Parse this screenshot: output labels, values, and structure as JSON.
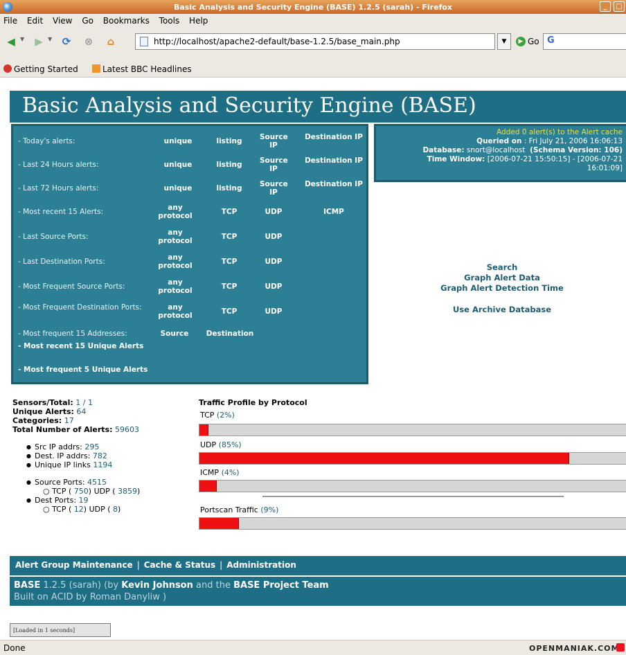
{
  "window": {
    "title": "Basic Analysis and Security Engine (BASE) 1.2.5 (sarah) - Firefox"
  },
  "menubar": [
    "File",
    "Edit",
    "View",
    "Go",
    "Bookmarks",
    "Tools",
    "Help"
  ],
  "navbar": {
    "url": "http://localhost/apache2-default/base-1.2.5/base_main.php",
    "go_label": "Go",
    "search_value": "G"
  },
  "bookmarks": [
    "Getting Started",
    "Latest BBC Headlines"
  ],
  "base": {
    "title": "Basic Analysis and Security Engine (BASE)",
    "menu": [
      {
        "label": "- Today's alerts:",
        "links": [
          "unique",
          "listing",
          "Source IP",
          "Destination IP"
        ]
      },
      {
        "label": "- Last 24 Hours alerts:",
        "links": [
          "unique",
          "listing",
          "Source IP",
          "Destination IP"
        ]
      },
      {
        "label": "- Last 72 Hours alerts:",
        "links": [
          "unique",
          "listing",
          "Source IP",
          "Destination IP"
        ]
      },
      {
        "label": "- Most recent 15 Alerts:",
        "links": [
          "any protocol",
          "TCP",
          "UDP",
          "ICMP"
        ]
      },
      {
        "label": "- Last Source Ports:",
        "links": [
          "any protocol",
          "TCP",
          "UDP"
        ]
      },
      {
        "label": "- Last Destination Ports:",
        "links": [
          "any protocol",
          "TCP",
          "UDP"
        ]
      },
      {
        "label": "- Most Frequent Source Ports:",
        "links": [
          "any protocol",
          "TCP",
          "UDP"
        ]
      },
      {
        "label": "- Most Frequent Destination Ports:",
        "links": [
          "any protocol",
          "TCP",
          "UDP"
        ]
      },
      {
        "label": "- Most frequent 15 Addresses:",
        "links": [
          "Source",
          "Destination"
        ]
      }
    ],
    "unique_recent": "- Most recent 15 Unique Alerts",
    "unique_frequent": "- Most frequent 5 Unique Alerts",
    "info": {
      "added": "Added 0 alert(s) to the Alert cache",
      "queried_label": "Queried on",
      "queried_value": ": Fri July 21, 2006 16:06:13",
      "database_label": "Database:",
      "database_value": "snort@localhost",
      "schema": "(Schema Version: 106)",
      "window_label": "Time Window:",
      "window_value": "[2006-07-21 15:50:15] - [2006-07-21",
      "window_value2": "16:01:09]"
    },
    "right_links": [
      "Search",
      "Graph Alert Data",
      "Graph Alert Detection Time",
      "Use Archive Database"
    ],
    "stats": {
      "sensors_label": "Sensors/Total:",
      "sensors_value": "1 / 1",
      "unique_label": "Unique Alerts:",
      "unique_value": "64",
      "categories_label": "Categories:",
      "categories_value": "17",
      "total_label": "Total Number of Alerts:",
      "total_value": "59603",
      "src_ip_label": "Src IP addrs:",
      "src_ip_value": "295",
      "dst_ip_label": "Dest. IP addrs:",
      "dst_ip_value": "782",
      "links_label": "Unique IP links",
      "links_value": "1194",
      "sport_label": "Source Ports:",
      "sport_value": "4515",
      "sport_tcp": "750",
      "sport_udp": "3859",
      "dport_label": "Dest Ports:",
      "dport_value": "19",
      "dport_tcp": "12",
      "dport_udp": "8",
      "tcp_label": "TCP",
      "udp_label": "UDP"
    },
    "traffic": {
      "title": "Traffic Profile by Protocol",
      "protocols": [
        {
          "name": "TCP",
          "pct": "(2%)",
          "value": 2
        },
        {
          "name": "UDP",
          "pct": "(85%)",
          "value": 85
        },
        {
          "name": "ICMP",
          "pct": "(4%)",
          "value": 4
        }
      ],
      "portscan": {
        "name": "Portscan Traffic",
        "pct": "(9%)",
        "value": 9
      }
    },
    "footer": {
      "links": [
        "Alert Group Maintenance",
        "Cache & Status",
        "Administration"
      ],
      "base": "BASE",
      "version": "1.2.5 (sarah) (by",
      "author": "Kevin Johnson",
      "and": "and the",
      "team": "BASE Project Team",
      "acid": "Built on ACID by Roman Danyliw )",
      "loaded": "[Loaded in 1 seconds]"
    }
  },
  "status": {
    "text": "Done",
    "watermark": "OPENMANIAK.COM"
  }
}
